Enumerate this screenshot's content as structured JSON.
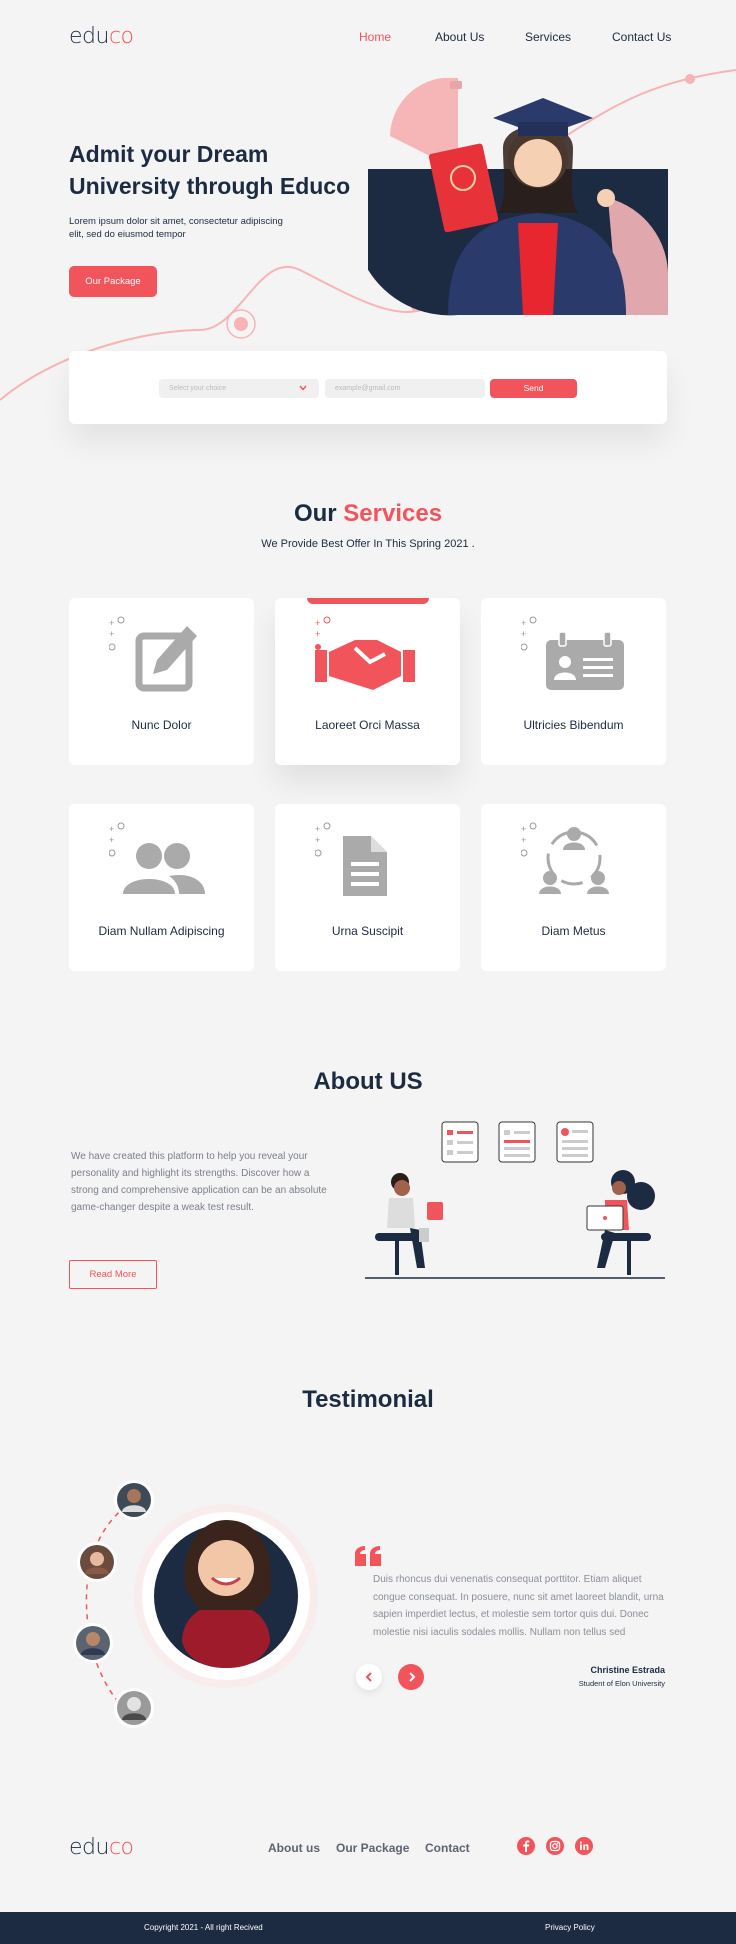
{
  "brand": {
    "logo_start": "edu",
    "logo_end": "co",
    "accent_color": "#f2545b",
    "dark_color": "#1c2b41"
  },
  "nav": {
    "items": [
      "Home",
      "About Us",
      "Services",
      "Contact Us"
    ],
    "active": "Home"
  },
  "hero": {
    "title": "Admit your Dream University through Educo",
    "text": "Lorem ipsum dolor sit amet, consectetur adipiscing elit, sed do eiusmod tempor",
    "button": "Our Package"
  },
  "form": {
    "select_placeholder": "Select your choice",
    "email_placeholder": "example@gmail.com",
    "send_label": "Send"
  },
  "services": {
    "title_start": "Our",
    "title_end": "Services",
    "subtitle": "We Provide Best Offer In This Spring 2021 .",
    "items": [
      {
        "label": "Nunc Dolor",
        "icon": "edit-icon"
      },
      {
        "label": "Laoreet Orci Massa",
        "icon": "handshake-icon"
      },
      {
        "label": "Ultricies Bibendum",
        "icon": "id-card-icon"
      },
      {
        "label": "Diam Nullam Adipiscing",
        "icon": "users-icon"
      },
      {
        "label": "Urna Suscipit",
        "icon": "document-icon"
      },
      {
        "label": "Diam Metus",
        "icon": "network-icon"
      }
    ]
  },
  "about": {
    "title": "About US",
    "text": "We have created this platform to help you reveal your personality and highlight its strengths. Discover how a strong and comprehensive application can be an absolute game-changer despite a weak test result.",
    "button": "Read More"
  },
  "testimonial": {
    "title": "Testimonial",
    "quote": "Duis rhoncus dui venenatis consequat porttitor. Etiam aliquet congue consequat. In posuere, nunc sit amet laoreet blandit, urna sapien imperdiet lectus, et molestie sem tortor quis dui. Donec molestie nisi iaculis sodales mollis. Nullam non tellus sed",
    "author": "Christine Estrada",
    "role": "Student of Elon University"
  },
  "footer": {
    "links": [
      "About us",
      "Our Package",
      "Contact"
    ],
    "social": [
      "facebook-icon",
      "instagram-icon",
      "linkedin-icon"
    ],
    "copyright": "Copyright 2021 - All right Recived",
    "privacy": "Privacy Policy"
  }
}
